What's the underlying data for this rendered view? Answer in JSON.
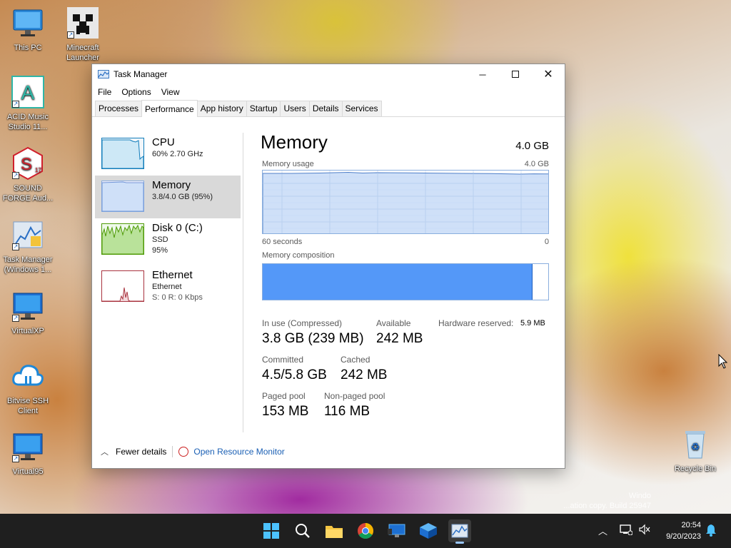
{
  "desktop": {
    "icons": [
      {
        "label": "This PC"
      },
      {
        "label": "Minecraft Launcher"
      },
      {
        "label": "ACID Music Studio 11..."
      },
      {
        "label": "SOUND FORGE Aud..."
      },
      {
        "label": "Task Manager (Windows 1..."
      },
      {
        "label": "VirtualXP"
      },
      {
        "label": "Bitvise SSH Client"
      },
      {
        "label": "Virtual95"
      },
      {
        "label": "Recycle Bin"
      }
    ],
    "watermark_line1": "Windo",
    "watermark_line2": "...ation copy. Build 25947"
  },
  "window": {
    "title": "Task Manager",
    "menu": [
      "File",
      "Options",
      "View"
    ],
    "tabs": [
      "Processes",
      "Performance",
      "App history",
      "Startup",
      "Users",
      "Details",
      "Services"
    ],
    "active_tab": "Performance",
    "left_items": [
      {
        "name": "CPU",
        "sub1": "60%  2.70 GHz",
        "sub2": ""
      },
      {
        "name": "Memory",
        "sub1": "3.8/4.0 GB (95%)",
        "sub2": ""
      },
      {
        "name": "Disk 0 (C:)",
        "sub1": "SSD",
        "sub2": "95%"
      },
      {
        "name": "Ethernet",
        "sub1": "Ethernet",
        "sub2": "S: 0  R: 0 Kbps"
      }
    ],
    "memory": {
      "title": "Memory",
      "total": "4.0 GB",
      "usage_label": "Memory usage",
      "usage_max": "4.0 GB",
      "time_left": "60 seconds",
      "time_right": "0",
      "composition_label": "Memory composition",
      "composition_in_use_fraction": 0.945,
      "stats": {
        "in_use_label": "In use (Compressed)",
        "in_use_value": "3.8 GB (239 MB)",
        "available_label": "Available",
        "available_value": "242 MB",
        "hw_reserved_label": "Hardware reserved:",
        "hw_reserved_value": "5.9 MB",
        "committed_label": "Committed",
        "committed_value": "4.5/5.8 GB",
        "cached_label": "Cached",
        "cached_value": "242 MB",
        "paged_label": "Paged pool",
        "paged_value": "153 MB",
        "nonpaged_label": "Non-paged pool",
        "nonpaged_value": "116 MB"
      }
    },
    "footer": {
      "fewer_details": "Fewer details",
      "resource_monitor": "Open Resource Monitor"
    }
  },
  "taskbar": {
    "time": "20:54",
    "date": "9/20/2023"
  },
  "colors": {
    "accent_blue": "#5498f8",
    "graph_border": "#8aaede",
    "disk_green": "#4e9a06",
    "ethernet_red": "#a8323e",
    "cpu_blue": "#117dbb"
  }
}
